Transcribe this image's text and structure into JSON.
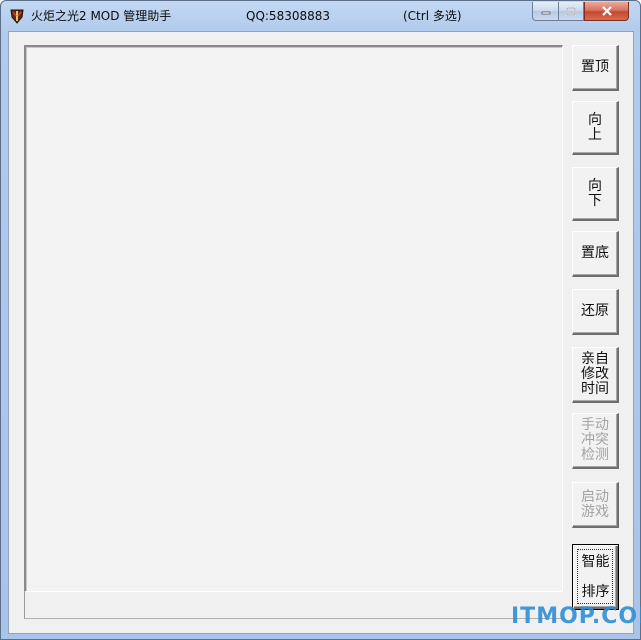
{
  "window": {
    "title_name": "火炬之光2 MOD 管理助手",
    "title_qq": "QQ:58308883",
    "title_hint": "(Ctrl 多选)"
  },
  "buttons": {
    "top": "置顶",
    "up": "向\n上",
    "down": "向\n下",
    "bottom": "置底",
    "restore": "还原",
    "modify_time": "亲自\n修改\n时间",
    "conflict_check": "手动\n冲突\n检测",
    "launch_game": "启动\n游戏",
    "smart_sort": "智能\n排序"
  },
  "watermark": "ITMOP.COM"
}
